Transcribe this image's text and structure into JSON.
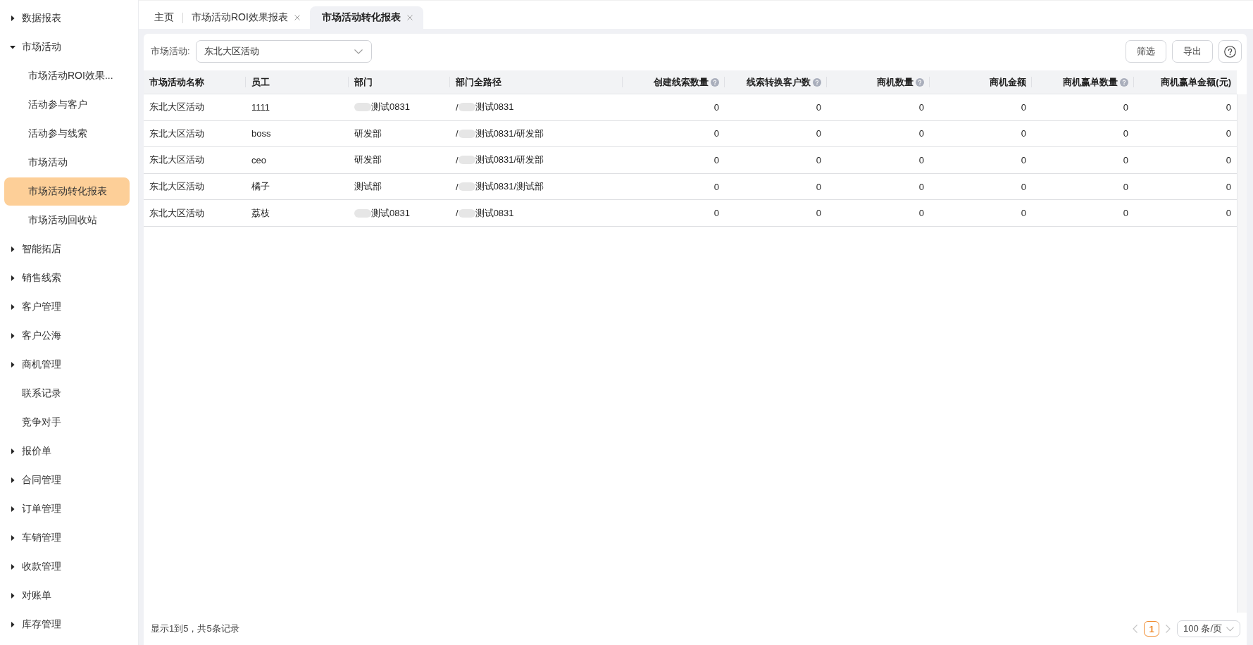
{
  "sidebar": {
    "items": [
      {
        "kind": "group",
        "label": "数据报表",
        "expanded": false,
        "selected": false
      },
      {
        "kind": "group",
        "label": "市场活动",
        "expanded": true,
        "selected": false,
        "children": [
          {
            "label": "市场活动ROI效果...",
            "selected": false
          },
          {
            "label": "活动参与客户",
            "selected": false
          },
          {
            "label": "活动参与线索",
            "selected": false
          },
          {
            "label": "市场活动",
            "selected": false
          },
          {
            "label": "市场活动转化报表",
            "selected": true
          },
          {
            "label": "市场活动回收站",
            "selected": false
          }
        ]
      },
      {
        "kind": "group",
        "label": "智能拓店",
        "expanded": false,
        "selected": false
      },
      {
        "kind": "group",
        "label": "销售线索",
        "expanded": false,
        "selected": false
      },
      {
        "kind": "group",
        "label": "客户管理",
        "expanded": false,
        "selected": false
      },
      {
        "kind": "group",
        "label": "客户公海",
        "expanded": false,
        "selected": false
      },
      {
        "kind": "group",
        "label": "商机管理",
        "expanded": false,
        "selected": false
      },
      {
        "kind": "link",
        "label": "联系记录",
        "selected": false
      },
      {
        "kind": "link",
        "label": "竞争对手",
        "selected": false
      },
      {
        "kind": "group",
        "label": "报价单",
        "expanded": false,
        "selected": false
      },
      {
        "kind": "group",
        "label": "合同管理",
        "expanded": false,
        "selected": false
      },
      {
        "kind": "group",
        "label": "订单管理",
        "expanded": false,
        "selected": false
      },
      {
        "kind": "group",
        "label": "车销管理",
        "expanded": false,
        "selected": false
      },
      {
        "kind": "group",
        "label": "收款管理",
        "expanded": false,
        "selected": false
      },
      {
        "kind": "group",
        "label": "对账单",
        "expanded": false,
        "selected": false
      },
      {
        "kind": "group",
        "label": "库存管理",
        "expanded": false,
        "selected": false
      }
    ]
  },
  "tabs": [
    {
      "label": "主页",
      "selected": false,
      "closable": false
    },
    {
      "label": "市场活动ROI效果报表",
      "selected": false,
      "closable": true
    },
    {
      "label": "市场活动转化报表",
      "selected": true,
      "closable": true
    }
  ],
  "toolbar": {
    "filter": {
      "label": "市场活动:",
      "value": "东北大区活动"
    },
    "buttons": [
      {
        "label": "筛选"
      },
      {
        "label": "导出"
      }
    ]
  },
  "table": {
    "columns": [
      {
        "label": "市场活动名称",
        "kind": "text",
        "hint": false
      },
      {
        "label": "员工",
        "kind": "text",
        "hint": false
      },
      {
        "label": "部门",
        "kind": "text",
        "hint": false
      },
      {
        "label": "部门全路径",
        "kind": "text",
        "hint": false
      },
      {
        "label": "创建线索数量",
        "kind": "number",
        "hint": true
      },
      {
        "label": "线索转换客户数",
        "kind": "number",
        "hint": true
      },
      {
        "label": "商机数量",
        "kind": "number",
        "hint": true
      },
      {
        "label": "商机金额",
        "kind": "number",
        "hint": false
      },
      {
        "label": "商机赢单数量",
        "kind": "number",
        "hint": true
      },
      {
        "label": "商机赢单金额(元)",
        "kind": "number",
        "hint": false
      }
    ],
    "rows": [
      {
        "activity": "东北大区活动",
        "employee": "1111",
        "department": {
          "text": "测试0831",
          "masked": true
        },
        "department_path": {
          "prefix": "/",
          "text": "测试0831",
          "masked": true
        },
        "values": [
          "0",
          "0",
          "0",
          "0",
          "0",
          "0"
        ]
      },
      {
        "activity": "东北大区活动",
        "employee": "boss",
        "department": {
          "text": "研发部",
          "masked": false
        },
        "department_path": {
          "prefix": "/",
          "text": "测试0831/研发部",
          "masked": true
        },
        "values": [
          "0",
          "0",
          "0",
          "0",
          "0",
          "0"
        ]
      },
      {
        "activity": "东北大区活动",
        "employee": "ceo",
        "department": {
          "text": "研发部",
          "masked": false
        },
        "department_path": {
          "prefix": "/",
          "text": "测试0831/研发部",
          "masked": true
        },
        "values": [
          "0",
          "0",
          "0",
          "0",
          "0",
          "0"
        ]
      },
      {
        "activity": "东北大区活动",
        "employee": "橘子",
        "department": {
          "text": "测试部",
          "masked": false
        },
        "department_path": {
          "prefix": "/",
          "text": "测试0831/测试部",
          "masked": true
        },
        "values": [
          "0",
          "0",
          "0",
          "0",
          "0",
          "0"
        ]
      },
      {
        "activity": "东北大区活动",
        "employee": "荔枝",
        "department": {
          "text": "测试0831",
          "masked": true
        },
        "department_path": {
          "prefix": "/",
          "text": "测试0831",
          "masked": true
        },
        "values": [
          "0",
          "0",
          "0",
          "0",
          "0",
          "0"
        ]
      }
    ]
  },
  "footer": {
    "summary": "显示1到5，共5条记录",
    "pagination": {
      "prev_disabled": true,
      "pages": [
        {
          "label": "1",
          "selected": true
        }
      ],
      "next_disabled": true,
      "page_size": "100 条/页"
    }
  }
}
